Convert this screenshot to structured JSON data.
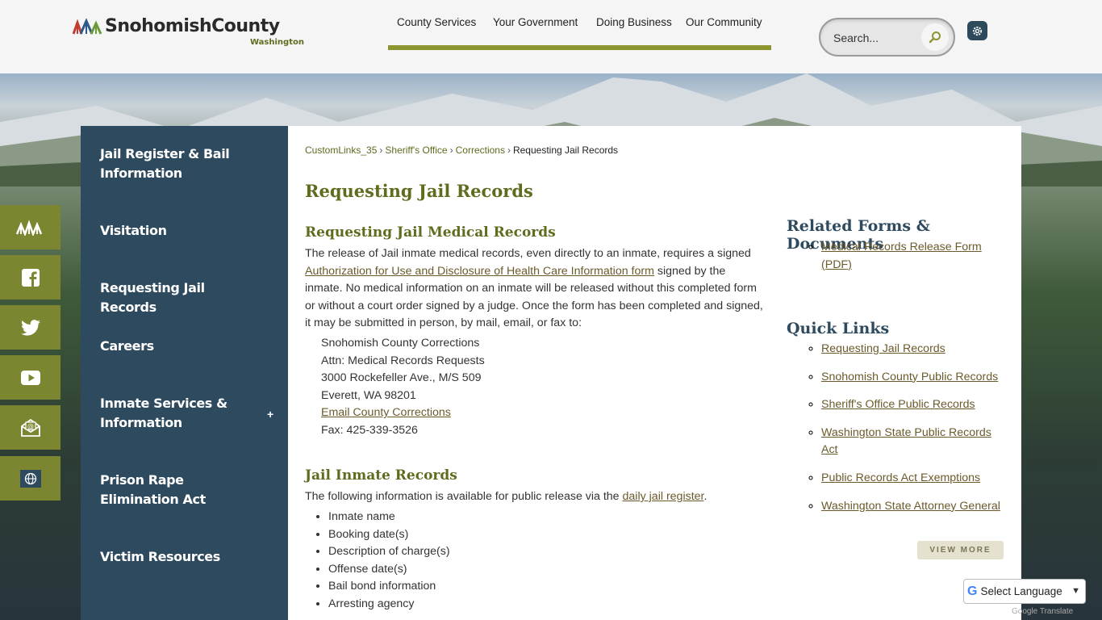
{
  "header": {
    "logo_name": "SnohomishCounty",
    "logo_sub": "Washington",
    "nav": [
      {
        "label": "County Services"
      },
      {
        "label": "Your Government"
      },
      {
        "label": "Doing Business"
      },
      {
        "label": "Our Community"
      }
    ],
    "search_placeholder": "Search..."
  },
  "sidebar": {
    "items": [
      {
        "label": "Jail Register & Bail Information"
      },
      {
        "label": "Visitation"
      },
      {
        "label": "Requesting Jail Records"
      },
      {
        "label": "Careers"
      },
      {
        "label": "Inmate Services & Information"
      },
      {
        "label": "Prison Rape Elimination Act"
      },
      {
        "label": "Victim Resources"
      }
    ],
    "expand_symbol": "+"
  },
  "social": [
    "county-logo-icon",
    "facebook-icon",
    "twitter-icon",
    "youtube-icon",
    "email-icon",
    "globe-icon"
  ],
  "breadcrumb": {
    "items": [
      "CustomLinks_35",
      "Sheriff's Office",
      "Corrections"
    ],
    "separator": "›",
    "current": "Requesting Jail Records"
  },
  "main": {
    "title": "Requesting Jail Records",
    "section1": {
      "heading": "Requesting Jail Medical Records",
      "intro": "The release of Jail inmate medical records, even directly to an inmate, requires a signed",
      "form_link": "Authorization for Use and Disclosure of Health Care Information form",
      "rest": " signed by the inmate. No medical information on an inmate will be released without this completed form or without a court order signed by a judge. Once the form has been completed and signed, it may be submitted in person, by mail, email, or fax to:",
      "address": [
        "Snohomish County Corrections",
        "Attn: Medical Records Requests",
        "3000 Rockefeller Ave., M/S 509",
        "Everett, WA 98201"
      ],
      "email_link": "Email County Corrections",
      "fax": "Fax: 425-339-3526"
    },
    "section2": {
      "heading": "Jail Inmate Records",
      "intro": "The following information is available for public release via the ",
      "register_link": "daily jail register",
      "period": ".",
      "items": [
        "Inmate name",
        "Booking date(s)",
        "Description of charge(s)",
        "Offense date(s)",
        "Bail bond information",
        "Arresting agency"
      ]
    }
  },
  "related": {
    "title": "Related Forms & Documents",
    "items": [
      "Medical Records Release Form (PDF)"
    ]
  },
  "quick_links": {
    "title": "Quick Links",
    "items": [
      "Requesting Jail Records",
      "Snohomish County Public Records",
      "Sheriff's Office Public Records",
      "Washington State Public Records Act",
      "Public Records Act Exemptions",
      "Washington State Attorney General"
    ],
    "view_more": "VIEW MORE"
  },
  "translate": {
    "label": "Select Language",
    "powered_by": "Google Translate"
  },
  "colors": {
    "olive": "#7c8530",
    "navy": "#2e4a5e",
    "heading_green": "#5f6b1d",
    "link_brown": "#6b5a2b"
  }
}
